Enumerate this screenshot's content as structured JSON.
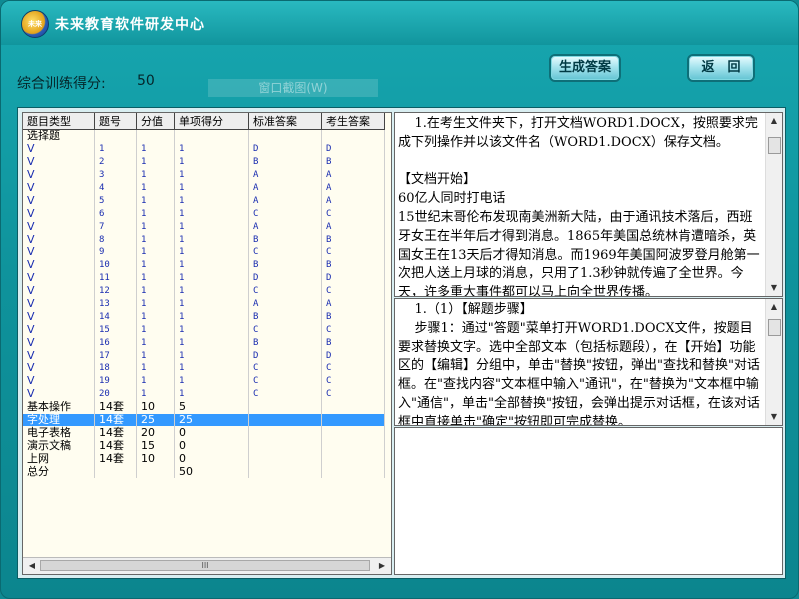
{
  "app": {
    "title": "未来教育软件研发中心",
    "logo_text": "未来"
  },
  "toolbar": {
    "generate_label": "生成答案",
    "back_label": "返　回"
  },
  "score": {
    "label": "综合训练得分:",
    "value": "50"
  },
  "ghost_label": "窗口截图(W)",
  "table": {
    "headers": [
      "题目类型",
      "题号",
      "分值",
      "单项得分",
      "标准答案",
      "考生答案"
    ],
    "rows": [
      {
        "type": "选择题",
        "num": "",
        "score": "",
        "single": "",
        "std": "",
        "user": "",
        "kind": "group"
      },
      {
        "type": "V",
        "num": "1",
        "score": "1",
        "single": "1",
        "std": "D",
        "user": "D",
        "kind": "sub"
      },
      {
        "type": "V",
        "num": "2",
        "score": "1",
        "single": "1",
        "std": "B",
        "user": "B",
        "kind": "sub"
      },
      {
        "type": "V",
        "num": "3",
        "score": "1",
        "single": "1",
        "std": "A",
        "user": "A",
        "kind": "sub"
      },
      {
        "type": "V",
        "num": "4",
        "score": "1",
        "single": "1",
        "std": "A",
        "user": "A",
        "kind": "sub"
      },
      {
        "type": "V",
        "num": "5",
        "score": "1",
        "single": "1",
        "std": "A",
        "user": "A",
        "kind": "sub"
      },
      {
        "type": "V",
        "num": "6",
        "score": "1",
        "single": "1",
        "std": "C",
        "user": "C",
        "kind": "sub"
      },
      {
        "type": "V",
        "num": "7",
        "score": "1",
        "single": "1",
        "std": "A",
        "user": "A",
        "kind": "sub"
      },
      {
        "type": "V",
        "num": "8",
        "score": "1",
        "single": "1",
        "std": "B",
        "user": "B",
        "kind": "sub"
      },
      {
        "type": "V",
        "num": "9",
        "score": "1",
        "single": "1",
        "std": "C",
        "user": "C",
        "kind": "sub"
      },
      {
        "type": "V",
        "num": "10",
        "score": "1",
        "single": "1",
        "std": "B",
        "user": "B",
        "kind": "sub"
      },
      {
        "type": "V",
        "num": "11",
        "score": "1",
        "single": "1",
        "std": "D",
        "user": "D",
        "kind": "sub"
      },
      {
        "type": "V",
        "num": "12",
        "score": "1",
        "single": "1",
        "std": "C",
        "user": "C",
        "kind": "sub"
      },
      {
        "type": "V",
        "num": "13",
        "score": "1",
        "single": "1",
        "std": "A",
        "user": "A",
        "kind": "sub"
      },
      {
        "type": "V",
        "num": "14",
        "score": "1",
        "single": "1",
        "std": "B",
        "user": "B",
        "kind": "sub"
      },
      {
        "type": "V",
        "num": "15",
        "score": "1",
        "single": "1",
        "std": "C",
        "user": "C",
        "kind": "sub"
      },
      {
        "type": "V",
        "num": "16",
        "score": "1",
        "single": "1",
        "std": "B",
        "user": "B",
        "kind": "sub"
      },
      {
        "type": "V",
        "num": "17",
        "score": "1",
        "single": "1",
        "std": "D",
        "user": "D",
        "kind": "sub"
      },
      {
        "type": "V",
        "num": "18",
        "score": "1",
        "single": "1",
        "std": "C",
        "user": "C",
        "kind": "sub"
      },
      {
        "type": "V",
        "num": "19",
        "score": "1",
        "single": "1",
        "std": "C",
        "user": "C",
        "kind": "sub"
      },
      {
        "type": "V",
        "num": "20",
        "score": "1",
        "single": "1",
        "std": "C",
        "user": "C",
        "kind": "sub"
      },
      {
        "type": "基本操作",
        "num": "14套",
        "score": "10",
        "single": "5",
        "std": "",
        "user": "",
        "kind": "group"
      },
      {
        "type": "字处理",
        "num": "14套",
        "score": "25",
        "single": "25",
        "std": "",
        "user": "",
        "kind": "group sel"
      },
      {
        "type": "电子表格",
        "num": "14套",
        "score": "20",
        "single": "0",
        "std": "",
        "user": "",
        "kind": "group"
      },
      {
        "type": "演示文稿",
        "num": "14套",
        "score": "15",
        "single": "0",
        "std": "",
        "user": "",
        "kind": "group"
      },
      {
        "type": "上网",
        "num": "14套",
        "score": "10",
        "single": "0",
        "std": "",
        "user": "",
        "kind": "group"
      },
      {
        "type": "总分",
        "num": "",
        "score": "",
        "single": "50",
        "std": "",
        "user": "",
        "kind": "group"
      }
    ],
    "hscroll_label": "III"
  },
  "question_text": "    1.在考生文件夹下，打开文档WORD1.DOCX，按照要求完成下列操作并以该文件名（WORD1.DOCX）保存文档。\n\n【文档开始】\n60亿人同时打电话\n15世纪末哥伦布发现南美洲新大陆，由于通讯技术落后，西班牙女王在半年后才得到消息。1865年美国总统林肯遭暗杀，英国女王在13天后才得知消息。而1969年美国阿波罗登月舱第一次把人送上月球的消息，只用了1.3秒钟就传遍了全世界。今天，许多重大事件都可以马上向全世界传播。",
  "steps_text": "    1.（1）【解题步骤】\n    步骤1：通过\"答题\"菜单打开WORD1.DOCX文件，按题目要求替换文字。选中全部文本（包括标题段），在【开始】功能区的【编辑】分组中，单击\"替换\"按钮，弹出\"查找和替换\"对话框。在\"查找内容\"文本框中输入\"通讯\"，在\"替换为\"文本框中输入\"通信\"，单击\"全部替换\"按钮，会弹出提示对话框，在该对话框中直接单击\"确定\"按钮即可完成替换。"
}
